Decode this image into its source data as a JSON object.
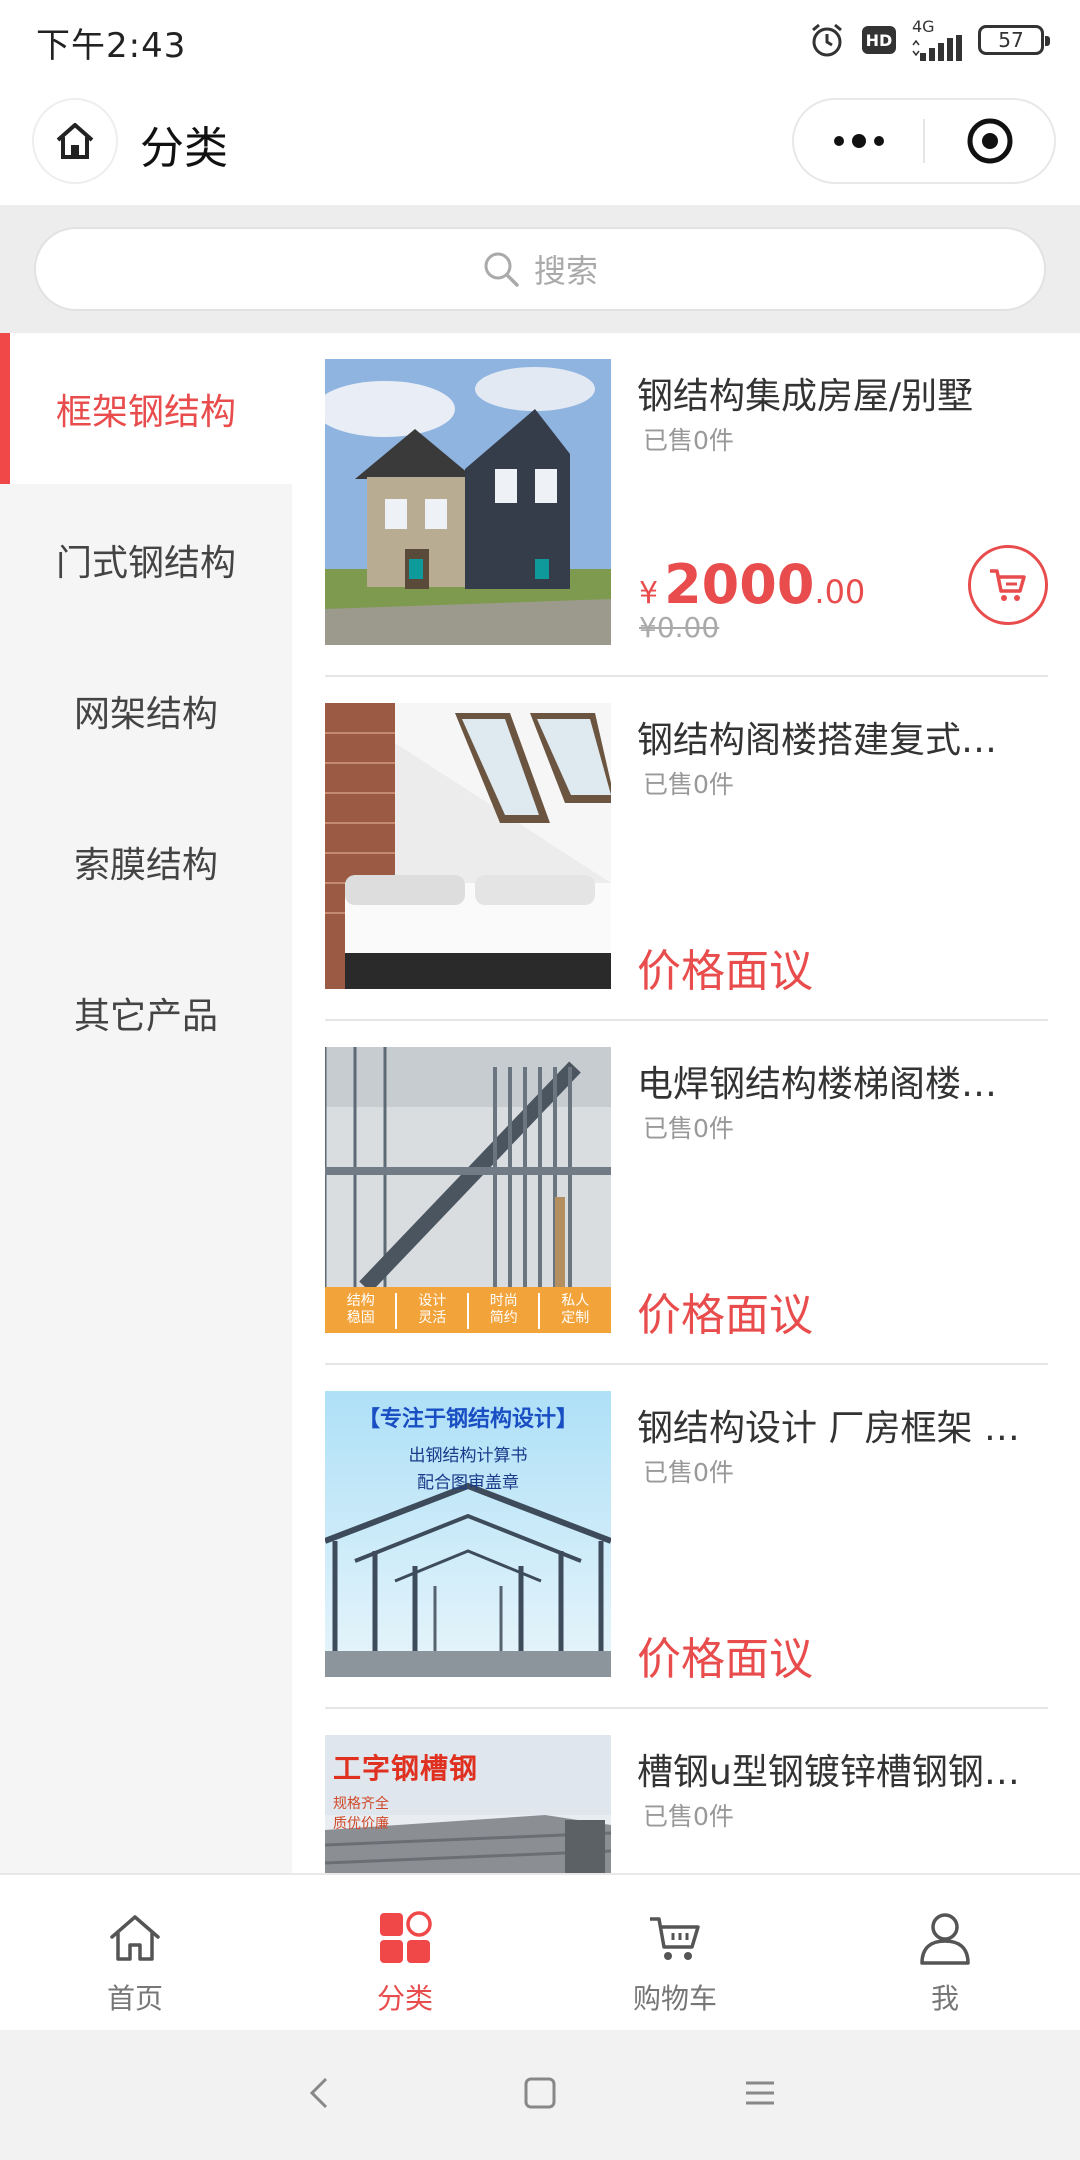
{
  "status": {
    "time": "下午2:43",
    "hd": "HD",
    "network": "4G",
    "battery": "57"
  },
  "nav": {
    "title": "分类"
  },
  "search": {
    "placeholder": "搜索"
  },
  "sidebar": {
    "items": [
      {
        "label": "框架钢结构",
        "active": true
      },
      {
        "label": "门式钢结构",
        "active": false
      },
      {
        "label": "网架结构",
        "active": false
      },
      {
        "label": "索膜结构",
        "active": false
      },
      {
        "label": "其它产品",
        "active": false
      }
    ]
  },
  "products": [
    {
      "name": "钢结构集成房屋/别墅",
      "sold": "已售0件",
      "price_symbol": "¥",
      "price_int": "2000",
      "price_dec": ".00",
      "price_old": "¥0.00"
    },
    {
      "name": "钢结构阁楼搭建复式…",
      "sold": "已售0件",
      "price_text": "价格面议"
    },
    {
      "name": "电焊钢结构楼梯阁楼…",
      "sold": "已售0件",
      "price_text": "价格面议",
      "image_badges": [
        {
          "line1": "结构",
          "line2": "稳固"
        },
        {
          "line1": "设计",
          "line2": "灵活"
        },
        {
          "line1": "时尚",
          "line2": "简约"
        },
        {
          "line1": "私人",
          "line2": "定制"
        }
      ]
    },
    {
      "name": "钢结构设计 厂房框架 …",
      "sold": "已售0件",
      "price_text": "价格面议",
      "image_title": "【专注于钢结构设计】",
      "image_sub1": "出钢结构计算书",
      "image_sub2": "配合图审盖章"
    },
    {
      "name": "槽钢u型钢镀锌槽钢钢…",
      "sold": "已售0件",
      "image_title": "工字钢槽钢",
      "image_sub1": "规格齐全",
      "image_sub2": "质优价廉"
    }
  ],
  "tabbar": {
    "items": [
      {
        "label": "首页",
        "icon": "home-icon"
      },
      {
        "label": "分类",
        "icon": "category-icon",
        "active": true
      },
      {
        "label": "购物车",
        "icon": "cart-icon"
      },
      {
        "label": "我",
        "icon": "user-icon"
      }
    ]
  },
  "colors": {
    "accent": "#e84c4c",
    "sidebar_bg": "#f5f5f5",
    "search_bg": "#ededed"
  }
}
